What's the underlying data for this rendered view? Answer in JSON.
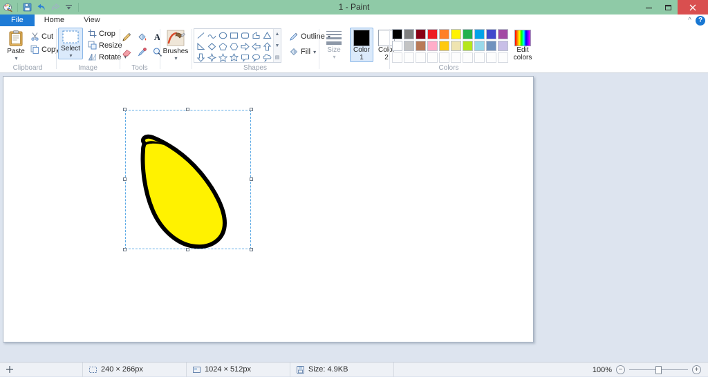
{
  "window": {
    "title": "1 - Paint",
    "minimize_label": "Minimize",
    "restore_label": "Restore",
    "close_label": "Close",
    "titlebar_color": "#8fcaa7",
    "close_color": "#d94f4f"
  },
  "quick_access": [
    {
      "name": "paint-app-icon",
      "label": "Paint"
    },
    {
      "name": "save-icon",
      "label": "Save"
    },
    {
      "name": "undo-icon",
      "label": "Undo"
    },
    {
      "name": "redo-icon",
      "label": "Redo"
    },
    {
      "name": "customize-qat-icon",
      "label": "Customize Quick Access Toolbar"
    }
  ],
  "tabs": [
    {
      "label": "File",
      "state": "file"
    },
    {
      "label": "Home",
      "state": "active"
    },
    {
      "label": "View",
      "state": "inactive"
    }
  ],
  "tabstrip_right": {
    "collapse_label": "^",
    "help_label": "?"
  },
  "ribbon": {
    "groups": [
      {
        "label": "Clipboard"
      },
      {
        "label": "Image"
      },
      {
        "label": "Tools"
      },
      {
        "label": ""
      },
      {
        "label": "Shapes"
      },
      {
        "label": ""
      },
      {
        "label": "Colors"
      }
    ],
    "clipboard": {
      "paste": "Paste",
      "cut": "Cut",
      "copy": "Copy"
    },
    "image": {
      "select": "Select",
      "crop": "Crop",
      "resize": "Resize",
      "rotate": "Rotate",
      "select_active": true
    },
    "tools": [
      {
        "name": "pencil-icon",
        "label": "Pencil"
      },
      {
        "name": "fill-bucket-icon",
        "label": "Fill with color"
      },
      {
        "name": "text-icon",
        "label": "Text"
      },
      {
        "name": "eraser-icon",
        "label": "Eraser"
      },
      {
        "name": "color-picker-icon",
        "label": "Color picker"
      },
      {
        "name": "magnifier-icon",
        "label": "Magnifier"
      }
    ],
    "brushes": {
      "label": "Brushes"
    },
    "shapes": {
      "items": [
        "line",
        "curve",
        "oval",
        "rectangle",
        "rounded-rectangle",
        "polygon",
        "triangle",
        "right-triangle",
        "diamond",
        "pentagon",
        "hexagon",
        "right-arrow",
        "left-arrow",
        "up-arrow",
        "down-arrow",
        "four-point-star",
        "five-point-star",
        "six-point-star",
        "rounded-callout",
        "oval-callout",
        "cloud-callout"
      ],
      "outline": "Outline",
      "fill": "Fill"
    },
    "size": {
      "label": "Size"
    },
    "colors": {
      "color1_label_line1": "Color",
      "color1_label_line2": "1",
      "color2_label_line1": "Color",
      "color2_label_line2": "2",
      "color1_value": "#000000",
      "color2_value": "#ffffff",
      "color1_active": true,
      "edit_colors_line1": "Edit",
      "edit_colors_line2": "colors",
      "palette_row1": [
        "#000000",
        "#7f7f7f",
        "#880015",
        "#ed1c24",
        "#ff7f27",
        "#fff200",
        "#22b14c",
        "#00a2e8",
        "#3f48cc",
        "#a349a4"
      ],
      "palette_row2": [
        "#ffffff",
        "#c3c3c3",
        "#b97a57",
        "#ffaec9",
        "#ffc90e",
        "#efe4b0",
        "#b5e61d",
        "#99d9ea",
        "#7092be",
        "#c8bfe7"
      ],
      "palette_row3": [
        "",
        "",
        "",
        "",
        "",
        "",
        "",
        "",
        "",
        ""
      ]
    }
  },
  "canvas": {
    "background": "#ffffff",
    "artwork_name": "banana-drawing",
    "artwork_fill": "#fff200",
    "artwork_stroke": "#000000",
    "selection": {
      "handles": [
        "nw",
        "n",
        "ne",
        "w",
        "e",
        "sw",
        "s",
        "se"
      ],
      "border_color": "#5aa9e6"
    }
  },
  "statusbar": {
    "cursor_icon": "crosshair-icon",
    "selection_size": "240 × 266px",
    "image_size": "1024 × 512px",
    "file_size": "Size: 4.9KB",
    "zoom_percent": "100%",
    "zoom_out_label": "−",
    "zoom_in_label": "+"
  }
}
